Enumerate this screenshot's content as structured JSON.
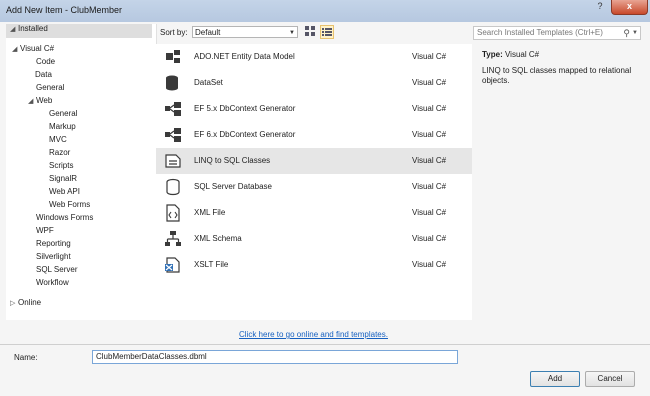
{
  "window": {
    "title": "Add New Item - ClubMember",
    "help": "?",
    "close": "x"
  },
  "tree": {
    "installed": "Installed",
    "online": "Online",
    "nodes": [
      {
        "label": "Visual C#"
      },
      {
        "label": "Code"
      },
      {
        "label": "Data"
      },
      {
        "label": "General"
      },
      {
        "label": "Web"
      },
      {
        "label": "General"
      },
      {
        "label": "Markup"
      },
      {
        "label": "MVC"
      },
      {
        "label": "Razor"
      },
      {
        "label": "Scripts"
      },
      {
        "label": "SignalR"
      },
      {
        "label": "Web API"
      },
      {
        "label": "Web Forms"
      },
      {
        "label": "Windows Forms"
      },
      {
        "label": "WPF"
      },
      {
        "label": "Reporting"
      },
      {
        "label": "Silverlight"
      },
      {
        "label": "SQL Server"
      },
      {
        "label": "Workflow"
      }
    ]
  },
  "toolbar": {
    "sort_label": "Sort by:",
    "sort_value": "Default",
    "search_placeholder": "Search Installed Templates (Ctrl+E)"
  },
  "templates": [
    {
      "name": "ADO.NET Entity Data Model",
      "lang": "Visual C#",
      "icon": "entity-model-icon"
    },
    {
      "name": "DataSet",
      "lang": "Visual C#",
      "icon": "database-icon"
    },
    {
      "name": "EF 5.x DbContext Generator",
      "lang": "Visual C#",
      "icon": "generator-icon"
    },
    {
      "name": "EF 6.x DbContext Generator",
      "lang": "Visual C#",
      "icon": "generator-icon"
    },
    {
      "name": "LINQ to SQL Classes",
      "lang": "Visual C#",
      "icon": "linq-icon"
    },
    {
      "name": "SQL Server Database",
      "lang": "Visual C#",
      "icon": "database-icon"
    },
    {
      "name": "XML File",
      "lang": "Visual C#",
      "icon": "xml-file-icon"
    },
    {
      "name": "XML Schema",
      "lang": "Visual C#",
      "icon": "xml-schema-icon"
    },
    {
      "name": "XSLT File",
      "lang": "Visual C#",
      "icon": "xslt-file-icon"
    }
  ],
  "online_link": "Click here to go online and find templates.",
  "details": {
    "type_label": "Type:",
    "type_value": "Visual C#",
    "description": "LINQ to SQL classes mapped to relational objects."
  },
  "name_field": {
    "label": "Name:",
    "value": "ClubMemberDataClasses.dbml"
  },
  "buttons": {
    "add": "Add",
    "cancel": "Cancel"
  }
}
